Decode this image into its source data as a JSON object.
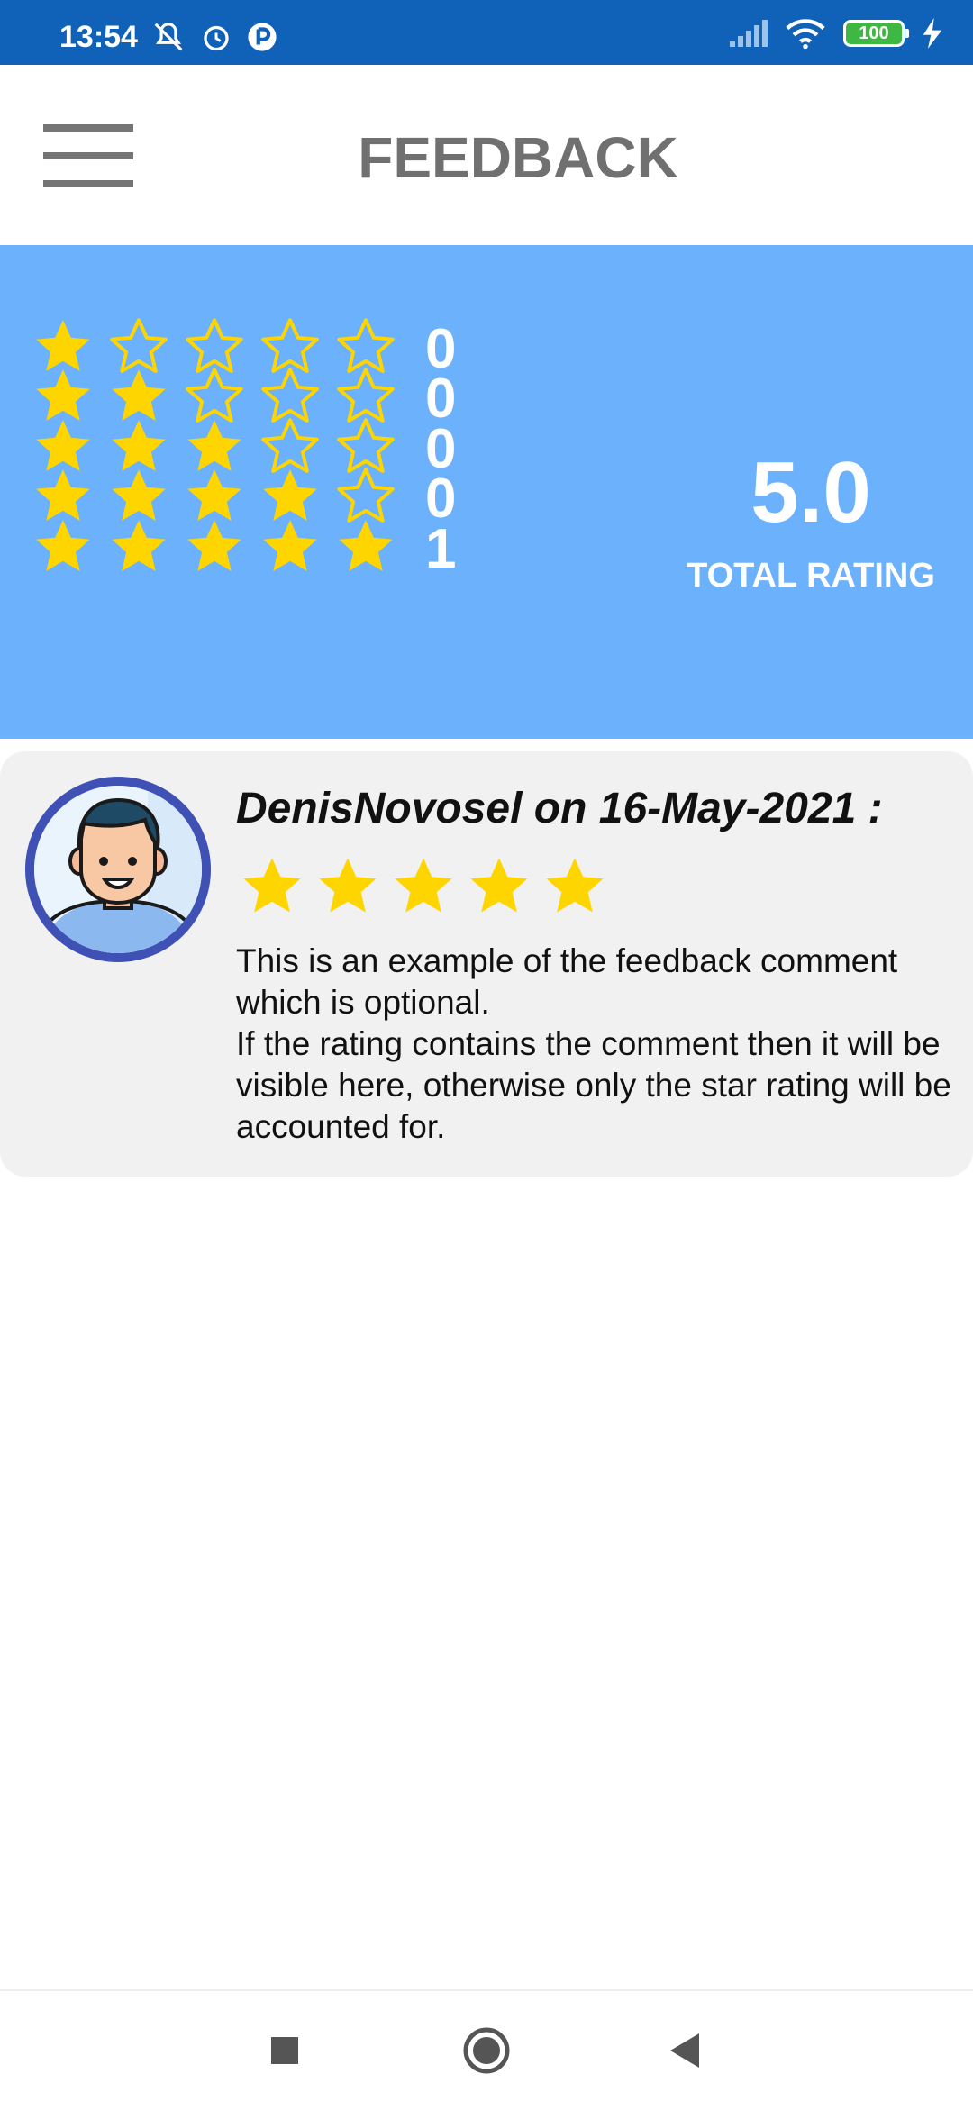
{
  "status_bar": {
    "time": "13:54",
    "battery": "100",
    "icons": [
      "mute-icon",
      "alarm-icon",
      "app-notification-icon",
      "signal-icon",
      "wifi-icon",
      "battery-icon",
      "charging-icon"
    ]
  },
  "app_bar": {
    "title": "FEEDBACK",
    "menu_icon": "hamburger-menu-icon"
  },
  "summary": {
    "rows": [
      {
        "stars": 1,
        "count": "0"
      },
      {
        "stars": 2,
        "count": "0"
      },
      {
        "stars": 3,
        "count": "0"
      },
      {
        "stars": 4,
        "count": "0"
      },
      {
        "stars": 5,
        "count": "1"
      }
    ],
    "max_stars": 5,
    "total_value": "5.0",
    "total_label": "TOTAL RATING"
  },
  "feedback": [
    {
      "header": "DenisNovosel on 16-May-2021 :",
      "rating": 5,
      "comment_line1": "This is an example of the feedback comment which is optional.",
      "comment_line2": "If the rating contains the comment then it will be visible here, otherwise only the star rating will be accounted for."
    }
  ],
  "colors": {
    "status_bar": "#0f62b7",
    "summary_bg": "#6bb1fc",
    "star_fill": "#ffd500",
    "avatar_border": "#3f51b5",
    "card_bg": "#f1f1f1",
    "title_text": "#707070"
  },
  "nav_bar": {
    "icons": [
      "recents-square-icon",
      "home-circle-icon",
      "back-triangle-icon"
    ]
  }
}
